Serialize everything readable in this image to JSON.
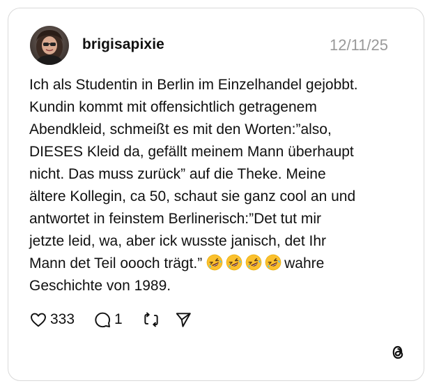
{
  "post": {
    "username": "brigisapixie",
    "timestamp": "12/11/25",
    "text_lines": [
      "Ich als Studentin in Berlin im Einzelhandel gejobbt.",
      "Kundin kommt mit offensichtlich getragenem",
      "Abendkleid, schmeißt es mit den Worten:”also,",
      "DIESES Kleid da, gefällt meinem Mann überhaupt",
      "nicht. Das muss zurück” auf die Theke. Meine",
      "ältere Kollegin, ca 50, schaut sie ganz cool an und",
      "antwortet in feinstem Berlinerisch:”Det tut mir",
      "jetzte leid, wa, aber ick wusste janisch, det Ihr",
      "Mann det Teil oooch trägt.”",
      "wahre",
      "Geschichte von 1989."
    ],
    "emoji": "rolling-on-the-floor-laughing",
    "emoji_count": 4
  },
  "actions": {
    "likes": "333",
    "replies": "1",
    "like_icon": "heart-icon",
    "reply_icon": "speech-bubble-icon",
    "repost_icon": "repost-icon",
    "share_icon": "paper-plane-icon"
  },
  "branding": {
    "logo_icon": "threads-logo-icon"
  },
  "colors": {
    "text": "#101010",
    "muted": "#999999",
    "border": "#d9d9d9",
    "emoji_face": "#FBC02D"
  }
}
